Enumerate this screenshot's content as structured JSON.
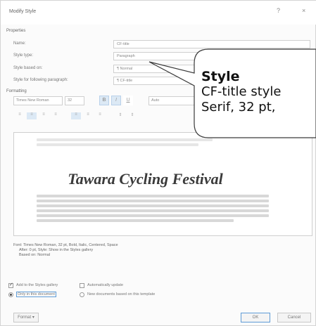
{
  "window": {
    "title": "Modify Style",
    "help_glyph": "?",
    "close_glyph": "×"
  },
  "properties": {
    "heading": "Properties",
    "name_label": "Name:",
    "name_value": "CF-title",
    "type_label": "Style type:",
    "type_value": "Paragraph",
    "based_label": "Style based on:",
    "based_value": "¶ Normal",
    "following_label": "Style for following paragraph:",
    "following_value": "¶ CF-title"
  },
  "formatting": {
    "heading": "Formatting",
    "font_value": "Times New Roman",
    "size_value": "32",
    "bold": "B",
    "italic": "I",
    "underline": "U",
    "color_value": "Auto"
  },
  "preview": {
    "sample_text": "Tawara Cycling Festival"
  },
  "description": {
    "line1": "Font: Times New Roman, 32 pt, Bold, Italic, Centered, Space",
    "line2": "After: 0 pt, Style: Show in the Styles gallery",
    "line3": "Based on: Normal"
  },
  "options": {
    "add_gallery": "Add to the Styles gallery",
    "auto_update": "Automatically update",
    "only_document": "Only in this document",
    "new_documents": "New documents based on this template"
  },
  "buttons": {
    "format": "Format ▾",
    "ok": "OK",
    "cancel": "Cancel"
  },
  "callout": {
    "title": "Style",
    "line1": "CF-title style",
    "line2": "Serif, 32 pt,"
  }
}
